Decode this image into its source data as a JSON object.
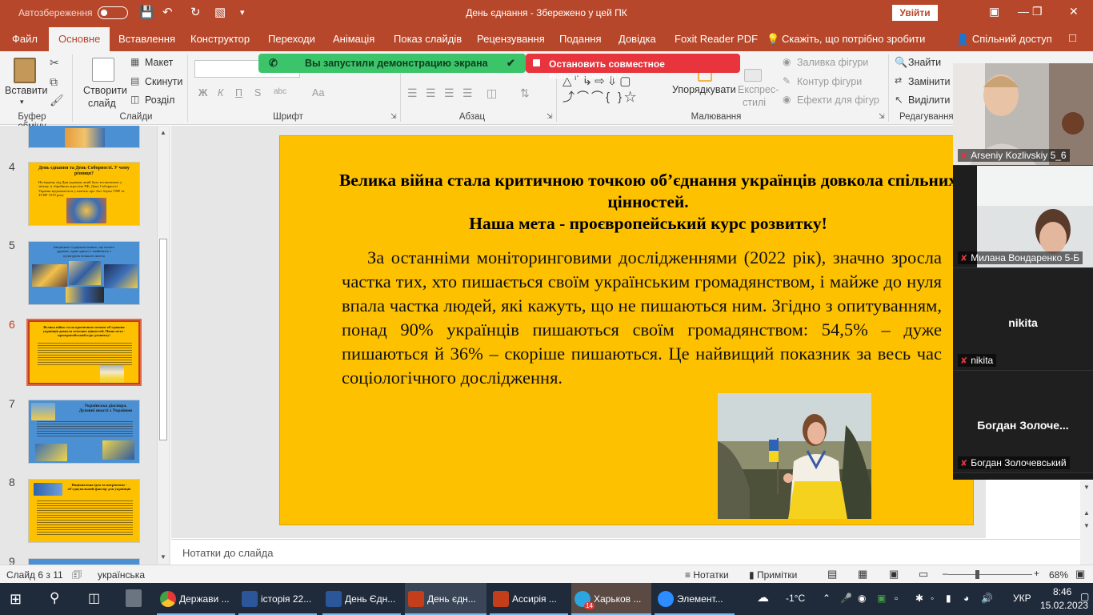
{
  "titlebar": {
    "autosave": "Автозбереження",
    "doc_title": "День єднання  -  Збережено у цей ПК",
    "signin": "Увійти"
  },
  "tabs": [
    "Файл",
    "Основне",
    "Вставлення",
    "Конструктор",
    "Переходи",
    "Анімація",
    "Показ слайдів",
    "Рецензування",
    "Подання",
    "Довідка",
    "Foxit Reader PDF",
    "Скажіть, що потрібно зробити"
  ],
  "share_label": "Спільний доступ",
  "ribbon": {
    "paste": "Вставити",
    "clipboard_group": "Буфер обміну",
    "new_slide_1": "Створити",
    "new_slide_2": "слайд",
    "layout": "Макет",
    "reset": "Скинути",
    "section": "Розділ",
    "slides_group": "Слайди",
    "font_group": "Шрифт",
    "bold": "Ж",
    "italic": "К",
    "underline": "П",
    "strike": "S",
    "ab": "abc",
    "aa": "Аа",
    "paragraph_group": "Абзац",
    "arrange": "Упорядкувати",
    "quick_styles_1": "Експрес-",
    "quick_styles_2": "стилі",
    "shape_fill": "Заливка фігури",
    "shape_outline": "Контур фігури",
    "shape_effects": "Ефекти для фігур",
    "drawing_group": "Малювання",
    "find": "Знайти",
    "replace": "Замінити",
    "select": "Виділити",
    "editing_group": "Редагування"
  },
  "screenshare": {
    "started": "Вы запустили демонстрацию экрана",
    "stop": "Остановить совместное использование"
  },
  "thumbnails": [
    {
      "num": "4",
      "title": "День єднання та День Соборності. У чому різниця?",
      "text": "На відміну від Дня єднання, який було встановлено у зв'язку зі збройною агресією РФ, День Соборності України відзначається у пам'ять про Акт Злуки УНР та ЗУНР 1919 року"
    },
    {
      "num": "5",
      "title": "Ініціатива з'єднувати інших, що всього дружне, один одного і знайомить з культурою вільного життя"
    },
    {
      "num": "6",
      "title": "Велика війна стала критичною точкою об'єднання українців довкола спільних цінностей. Наша мета - проєвропейський курс розвитку!"
    },
    {
      "num": "7",
      "title": "Українська діаспора. Духовні якості з Україною"
    },
    {
      "num": "8",
      "title": "Національна ідея та патріотизм - об'єднувальний фактор для українців"
    },
    {
      "num": "9"
    }
  ],
  "slide": {
    "heading_1": "Велика війна стала критичною точкою об’єднання українців довкола спільних цінностей.",
    "heading_2": "Наша мета - проєвропейський курс розвитку!",
    "body": "За останніми моніторинговими дослідженнями (2022 рік), значно зросла частка тих, хто пишається своїм українським громадянством, і майже до нуля впала частка людей, які кажуть, що не пишаються ним. Згідно з опитуванням, понад 90% українців пишаються своїм громадянством: 54,5% – дуже пишаються й 36% – скоріше пишаються. Це найвищий показник за весь час соціологічного дослідження."
  },
  "notes_placeholder": "Нотатки до слайда",
  "participants": [
    {
      "name": "Arseniy Kozlivskiy 5_6",
      "video": true
    },
    {
      "name": "Милана Вондаренко 5-Б",
      "video": true
    },
    {
      "name": "nikita",
      "display": "nikita",
      "video": false
    },
    {
      "name": "Богдан Золочевський",
      "display": "Богдан  Золоче...",
      "video": false
    }
  ],
  "statusbar": {
    "slide_of": "Слайд 6 з 11",
    "language": "українська",
    "notes": "Нотатки",
    "comments": "Примітки",
    "zoom": "68%"
  },
  "taskbar": {
    "apps": [
      {
        "label": "Держави ...",
        "color": "#e64a19"
      },
      {
        "label": "історія 22...",
        "color": "#2b579a"
      },
      {
        "label": "День Єдн...",
        "color": "#2b579a"
      },
      {
        "label": "День єдн...",
        "color": "#c43e1c"
      },
      {
        "label": "Ассирія ...",
        "color": "#c43e1c"
      },
      {
        "label": "Харьков ...",
        "color": "#2ca5e0",
        "badge": "14"
      },
      {
        "label": "Элемент...",
        "color": "#2d8cff"
      }
    ],
    "temperature": "-1°C",
    "lang": "УКР",
    "time": "8:46",
    "date": "15.02.2023"
  },
  "colors": {
    "brand": "#b7472a",
    "slide_bg": "#fec100",
    "share_green": "#3cc46a",
    "share_red": "#e8343c"
  }
}
